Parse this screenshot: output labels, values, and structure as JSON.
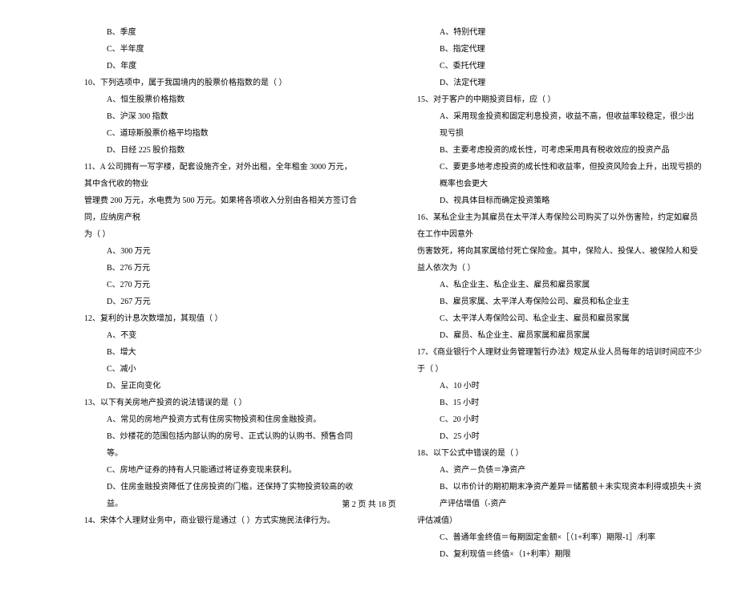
{
  "left_column": {
    "q9_options": [
      "B、季度",
      "C、半年度",
      "D、年度"
    ],
    "q10": {
      "text": "10、下列选项中，属于我国境内的股票价格指数的是（    ）",
      "options": [
        "A、恒生股票价格指数",
        "B、沪深 300 指数",
        "C、道琼斯股票价格平均指数",
        "D、日经 225 股价指数"
      ]
    },
    "q11": {
      "text": "11、A 公司拥有一写字楼，配套设施齐全，对外出租，全年租金 3000 万元，其中含代收的物业",
      "cont1": "管理费 200 万元，水电费为 500 万元。如果将各项收入分别由各相关方签订合同，应纳房产税",
      "cont2": "为（    ）",
      "options": [
        "A、300 万元",
        "B、276 万元",
        "C、270 万元",
        "D、267 万元"
      ]
    },
    "q12": {
      "text": "12、复利的计息次数增加，其现值（    ）",
      "options": [
        "A、不变",
        "B、增大",
        "C、减小",
        "D、呈正向变化"
      ]
    },
    "q13": {
      "text": "13、以下有关房地产投资的说法错误的是（    ）",
      "options": [
        "A、常见的房地产投资方式有住房实物投资和住房金融投资。",
        "B、炒楼花的范围包括内部认购的房号、正式认购的认购书、预售合同等。",
        "C、房地产证券的持有人只能通过将证券变现来获利。",
        "D、住房金融投资降低了住房投资的门槛，还保持了实物投资较高的收益。"
      ]
    },
    "q14": {
      "text": "14、宋体个人理财业务中，商业银行是通过（    ）方式实施民法律行为。"
    }
  },
  "right_column": {
    "q14_options": [
      "A、特别代理",
      "B、指定代理",
      "C、委托代理",
      "D、法定代理"
    ],
    "q15": {
      "text": "15、对于客户的中期投资目标，应（    ）",
      "options": [
        "A、采用现金投资和固定利息投资，收益不高，但收益率较稳定，很少出现亏损",
        "B、主要考虑投资的成长性，可考虑采用具有税收效应的投资产品",
        "C、要更多地考虑投资的成长性和收益率，但投资风险会上升，出现亏损的概率也会更大",
        "D、视具体目标而确定投资策略"
      ]
    },
    "q16": {
      "text": "16、某私企业主为其雇员在太平洋人寿保险公司购买了以外伤害险，约定如雇员在工作中因意外",
      "cont1": "伤害致死，将向其家属给付死亡保险金。其中，保险人、投保人、被保险人和受益人依次为（    ）",
      "options": [
        "A、私企业主、私企业主、雇员和雇员家属",
        "B、雇员家属、太平洋人寿保险公司、雇员和私企业主",
        "C、太平洋人寿保险公司、私企业主、雇员和雇员家属",
        "D、雇员、私企业主、雇员家属和雇员家属"
      ]
    },
    "q17": {
      "text": "17、《商业银行个人理财业务管理暂行办法》规定从业人员每年的培训时间应不少于（    ）",
      "options": [
        "A、10 小时",
        "B、15 小时",
        "C、20 小时",
        "D、25 小时"
      ]
    },
    "q18": {
      "text": "18、以下公式中错误的是（    ）",
      "options": [
        "A、资产－负债＝净资产",
        "B、以市价计的期初期末净资产差异＝储蓄额＋未实现资本利得或损失＋资产评估增值（-资产"
      ],
      "cont1": "评估减值）",
      "options2": [
        "C、普通年金终值＝每期固定金额×［（1+利率）期限-1］/利率",
        "D、复利现值＝终值×（1+利率）期限"
      ]
    }
  },
  "footer": "第 2 页 共 18 页"
}
